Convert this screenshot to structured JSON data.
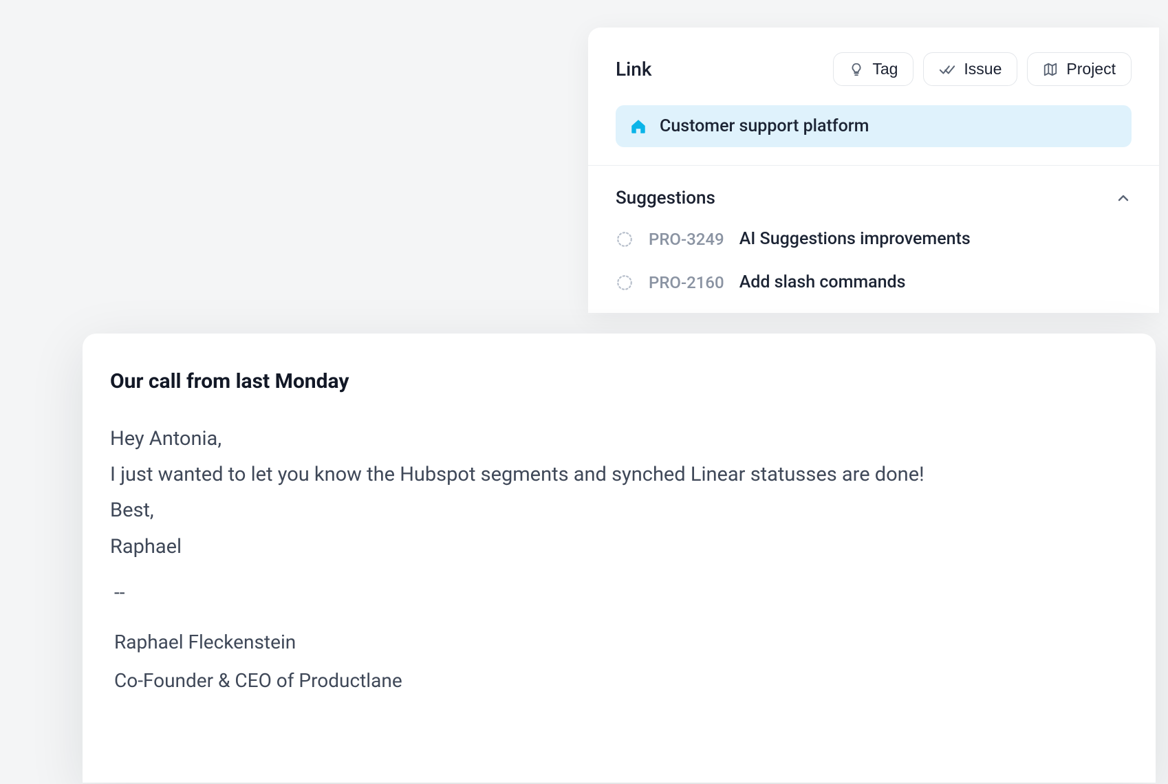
{
  "panel": {
    "title": "Link",
    "buttons": {
      "tag": "Tag",
      "issue": "Issue",
      "project": "Project"
    },
    "chip": "Customer support platform",
    "suggestions_title": "Suggestions",
    "suggestions": [
      {
        "id": "PRO-3249",
        "title": "AI Suggestions improvements"
      },
      {
        "id": "PRO-2160",
        "title": "Add slash commands"
      }
    ]
  },
  "email": {
    "subject": "Our call from last Monday",
    "line1": "Hey Antonia,",
    "line2": "I just wanted to let you know the Hubspot segments and synched Linear statusses are done!",
    "line3": "Best,",
    "line4": "Raphael",
    "sig_dashes": "--",
    "sig_name": "Raphael Fleckenstein",
    "sig_title": "Co-Founder & CEO of Productlane"
  },
  "colors": {
    "chip_bg": "#dff2fc",
    "chip_icon": "#0bb4e8"
  }
}
